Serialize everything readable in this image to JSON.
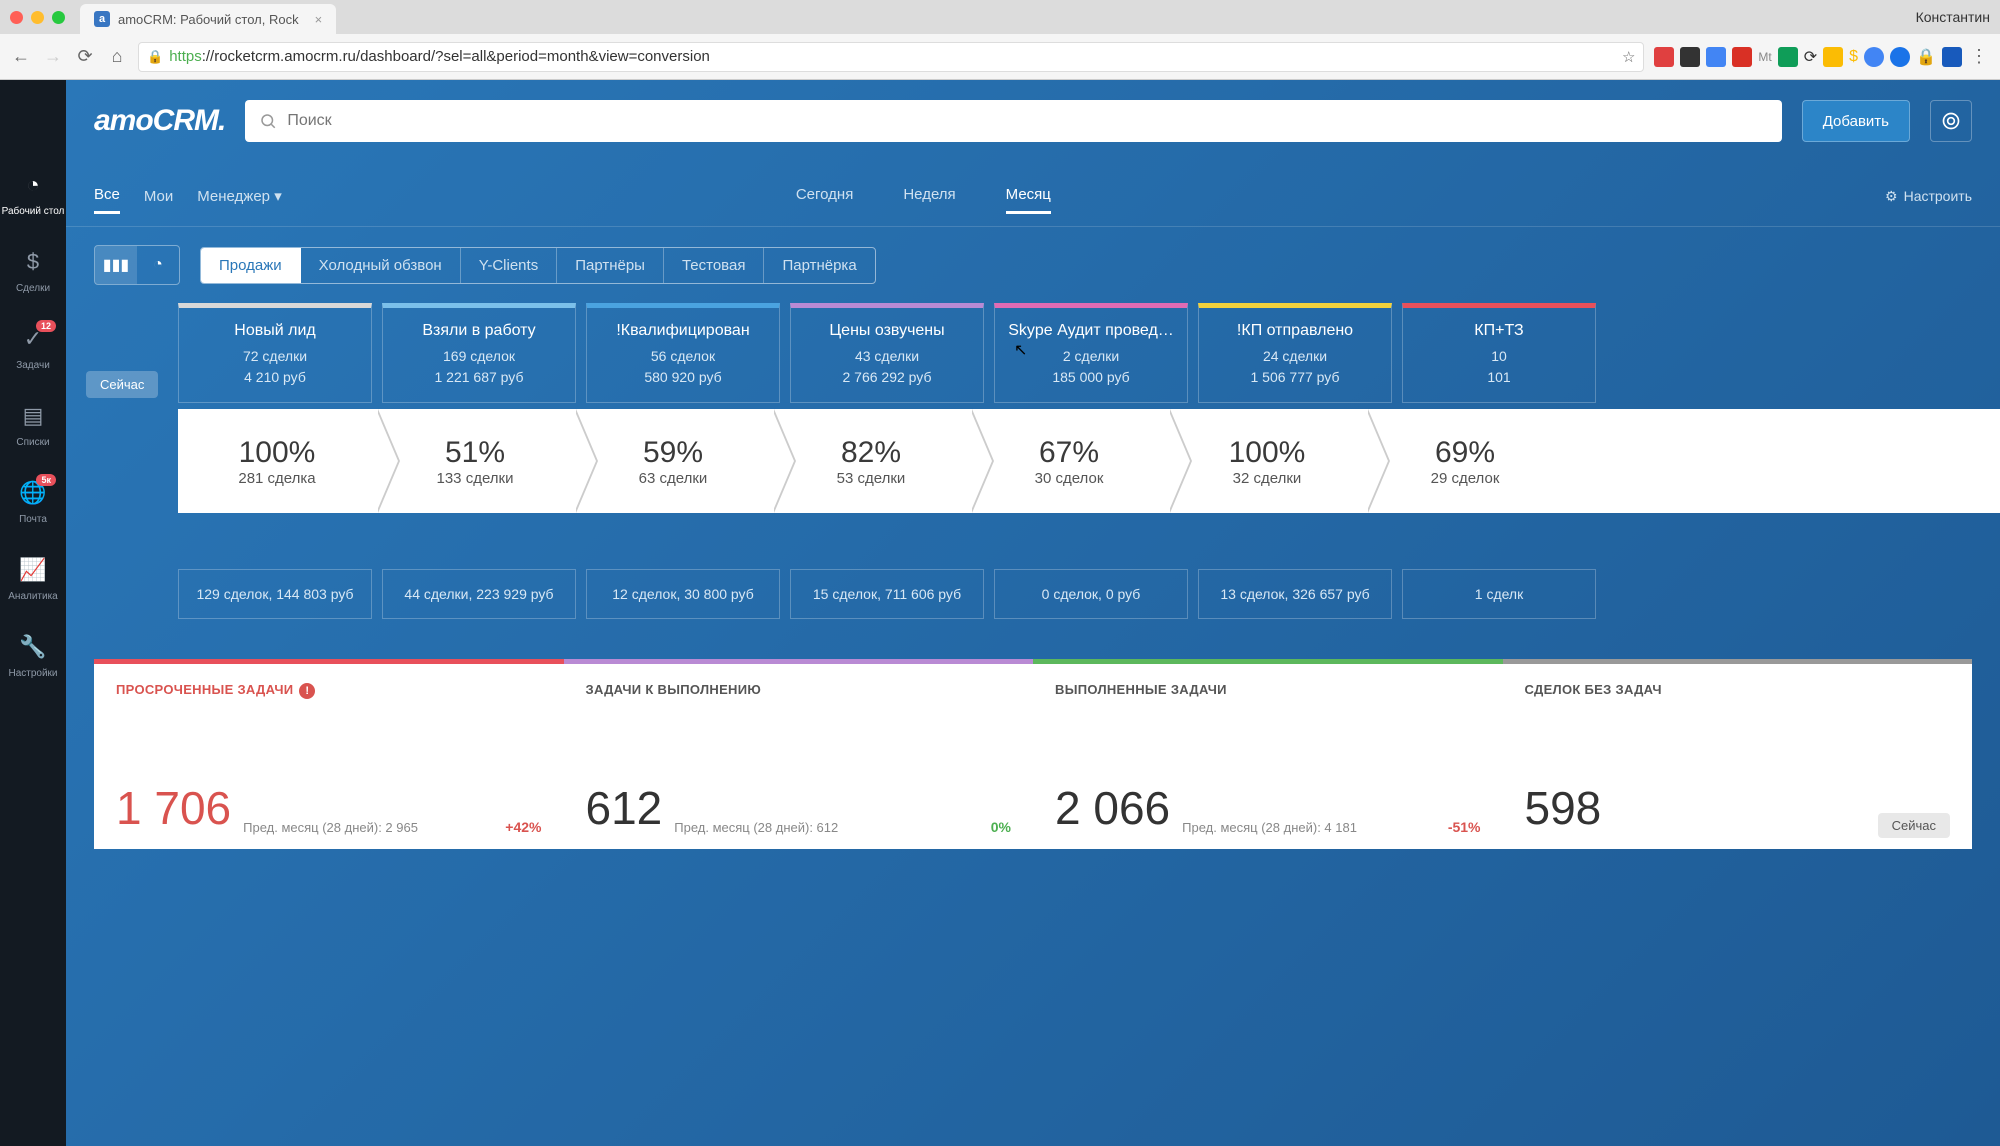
{
  "browser": {
    "tab_title": "amoCRM: Рабочий стол, Rock",
    "user": "Константин",
    "url_https": "https",
    "url_rest": "://rocketcrm.amocrm.ru/dashboard/?sel=all&period=month&view=conversion"
  },
  "header": {
    "logo": "amoCRM.",
    "search_placeholder": "Поиск",
    "add_button": "Добавить"
  },
  "sidebar": {
    "items": [
      {
        "label": "Рабочий стол",
        "badge": ""
      },
      {
        "label": "Сделки",
        "badge": ""
      },
      {
        "label": "Задачи",
        "badge": "12"
      },
      {
        "label": "Списки",
        "badge": ""
      },
      {
        "label": "Почта",
        "badge": "5к"
      },
      {
        "label": "Аналитика",
        "badge": ""
      },
      {
        "label": "Настройки",
        "badge": ""
      }
    ]
  },
  "filters": {
    "scopes": [
      "Все",
      "Мои",
      "Менеджер"
    ],
    "periods": [
      "Сегодня",
      "Неделя",
      "Месяц"
    ],
    "settings": "Настроить"
  },
  "pipelines": [
    "Продажи",
    "Холодный обзвон",
    "Y-Clients",
    "Партнёры",
    "Тестовая",
    "Партнёрка"
  ],
  "now_label": "Сейчас",
  "stages": [
    {
      "title": "Новый лид",
      "deals": "72 сделки",
      "sum": "4 210 руб",
      "color": "#d8d8d8"
    },
    {
      "title": "Взяли в работу",
      "deals": "169 сделок",
      "sum": "1 221 687 руб",
      "color": "#7bc0ea"
    },
    {
      "title": "!Квалифицирован",
      "deals": "56 сделок",
      "sum": "580 920 руб",
      "color": "#4aa3e0"
    },
    {
      "title": "Цены озвучены",
      "deals": "43 сделки",
      "sum": "2 766 292 руб",
      "color": "#b98ad4"
    },
    {
      "title": "Skype Аудит провед…",
      "deals": "2 сделки",
      "sum": "185 000 руб",
      "color": "#e06bb4"
    },
    {
      "title": "!КП отправлено",
      "deals": "24 сделки",
      "sum": "1 506 777 руб",
      "color": "#f2d13c"
    },
    {
      "title": "КП+ТЗ",
      "deals": "10",
      "sum": "101",
      "color": "#e8505b"
    }
  ],
  "conversion": [
    {
      "pct": "100%",
      "deals": "281 сделка"
    },
    {
      "pct": "51%",
      "deals": "133 сделки"
    },
    {
      "pct": "59%",
      "deals": "63 сделки"
    },
    {
      "pct": "82%",
      "deals": "53 сделки"
    },
    {
      "pct": "67%",
      "deals": "30 сделок"
    },
    {
      "pct": "100%",
      "deals": "32 сделки"
    },
    {
      "pct": "69%",
      "deals": "29 сделок"
    }
  ],
  "lost": [
    "129 сделок, 144 803 руб",
    "44 сделки, 223 929 руб",
    "12 сделок, 30 800 руб",
    "15 сделок, 711 606 руб",
    "0 сделок, 0 руб",
    "13 сделок, 326 657 руб",
    "1 сделк"
  ],
  "tasks": [
    {
      "title": "ПРОСРОЧЕННЫЕ ЗАДАЧИ",
      "num": "1 706",
      "delta": "+42%",
      "prev": "Пред. месяц (28 дней): 2 965",
      "color": "#e8505b",
      "numClass": "",
      "titleClass": "red",
      "warn": true
    },
    {
      "title": "ЗАДАЧИ К ВЫПОЛНЕНИЮ",
      "num": "612",
      "delta": "0%",
      "prev": "Пред. месяц (28 дней): 612",
      "color": "#b98ad4",
      "numClass": "dark",
      "titleClass": ""
    },
    {
      "title": "ВЫПОЛНЕННЫЕ ЗАДАЧИ",
      "num": "2 066",
      "delta": "-51%",
      "prev": "Пред. месяц (28 дней): 4 181",
      "color": "#5cb85c",
      "numClass": "dark",
      "titleClass": ""
    },
    {
      "title": "СДЕЛОК БЕЗ ЗАДАЧ",
      "num": "598",
      "delta": "",
      "prev": "",
      "color": "#999",
      "numClass": "dark",
      "titleClass": "",
      "now": "Сейчас"
    }
  ]
}
